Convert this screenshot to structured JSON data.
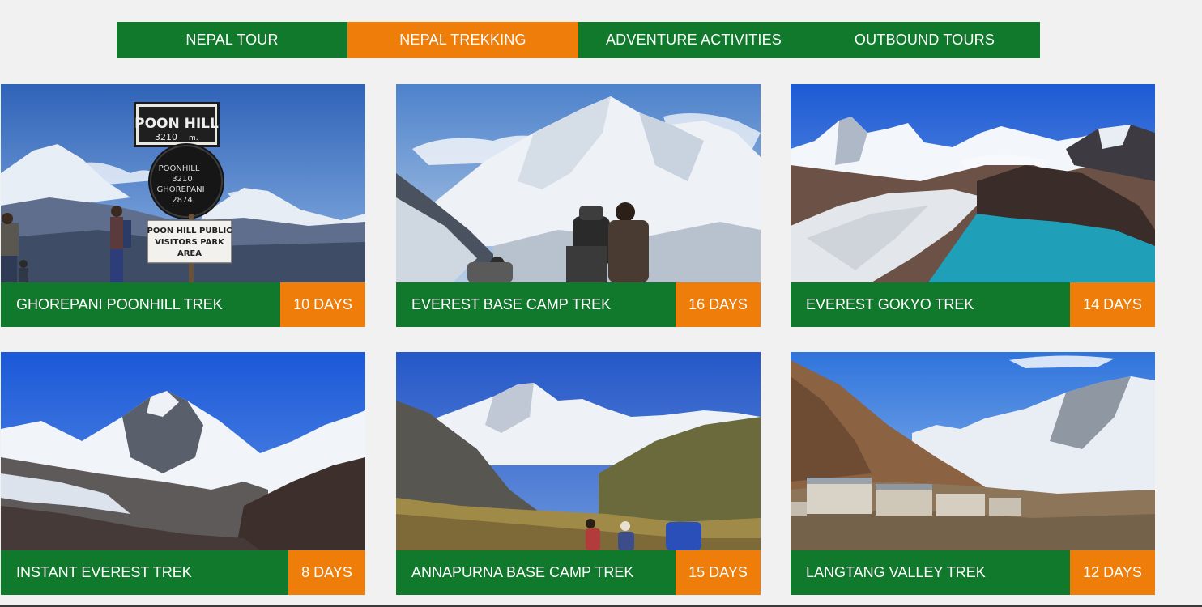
{
  "tabs": [
    {
      "label": "NEPAL TOUR",
      "active": false
    },
    {
      "label": "NEPAL TREKKING",
      "active": true
    },
    {
      "label": "ADVENTURE ACTIVITIES",
      "active": false
    },
    {
      "label": "OUTBOUND TOURS",
      "active": false
    }
  ],
  "colors": {
    "primary": "#11792c",
    "accent": "#ee7d0a",
    "background": "#f1f1f1"
  },
  "cards": [
    {
      "title": "GHOREPANI POONHILL TREK",
      "duration": "10 DAYS",
      "sign": {
        "top": "POON HILL",
        "altitude": "3210",
        "round_1": "POONHILL",
        "round_2": "3210",
        "round_3": "GHOREPANI",
        "round_4": "2874",
        "board_1": "POON HILL PUBLIC",
        "board_2": "VISITORS PARK",
        "board_3": "AREA"
      }
    },
    {
      "title": "EVEREST BASE CAMP TREK",
      "duration": "16 DAYS"
    },
    {
      "title": "EVEREST GOKYO TREK",
      "duration": "14 DAYS"
    },
    {
      "title": "INSTANT EVEREST TREK",
      "duration": "8 DAYS"
    },
    {
      "title": "ANNAPURNA BASE CAMP TREK",
      "duration": "15 DAYS"
    },
    {
      "title": "LANGTANG VALLEY TREK",
      "duration": "12 DAYS"
    }
  ]
}
